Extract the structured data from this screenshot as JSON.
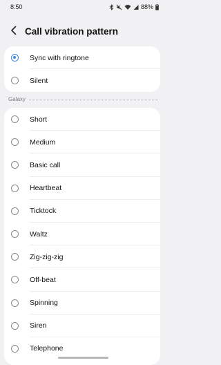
{
  "status_bar": {
    "time": "8:50",
    "battery": "88%",
    "icons": [
      "bluetooth-icon",
      "mute-icon",
      "wifi-icon",
      "signal-icon",
      "battery-icon"
    ]
  },
  "header": {
    "back_icon": "back-arrow-icon",
    "title": "Call vibration pattern"
  },
  "top_options": [
    {
      "label": "Sync with ringtone",
      "selected": true
    },
    {
      "label": "Silent",
      "selected": false
    }
  ],
  "section": {
    "label": "Galaxy"
  },
  "galaxy_options": [
    {
      "label": "Short"
    },
    {
      "label": "Medium"
    },
    {
      "label": "Basic call"
    },
    {
      "label": "Heartbeat"
    },
    {
      "label": "Ticktock"
    },
    {
      "label": "Waltz"
    },
    {
      "label": "Zig-zig-zig"
    },
    {
      "label": "Off-beat"
    },
    {
      "label": "Spinning"
    },
    {
      "label": "Siren"
    },
    {
      "label": "Telephone"
    }
  ],
  "colors": {
    "background": "#f1f1f3",
    "card": "#ffffff",
    "accent": "#3e8ae6"
  }
}
